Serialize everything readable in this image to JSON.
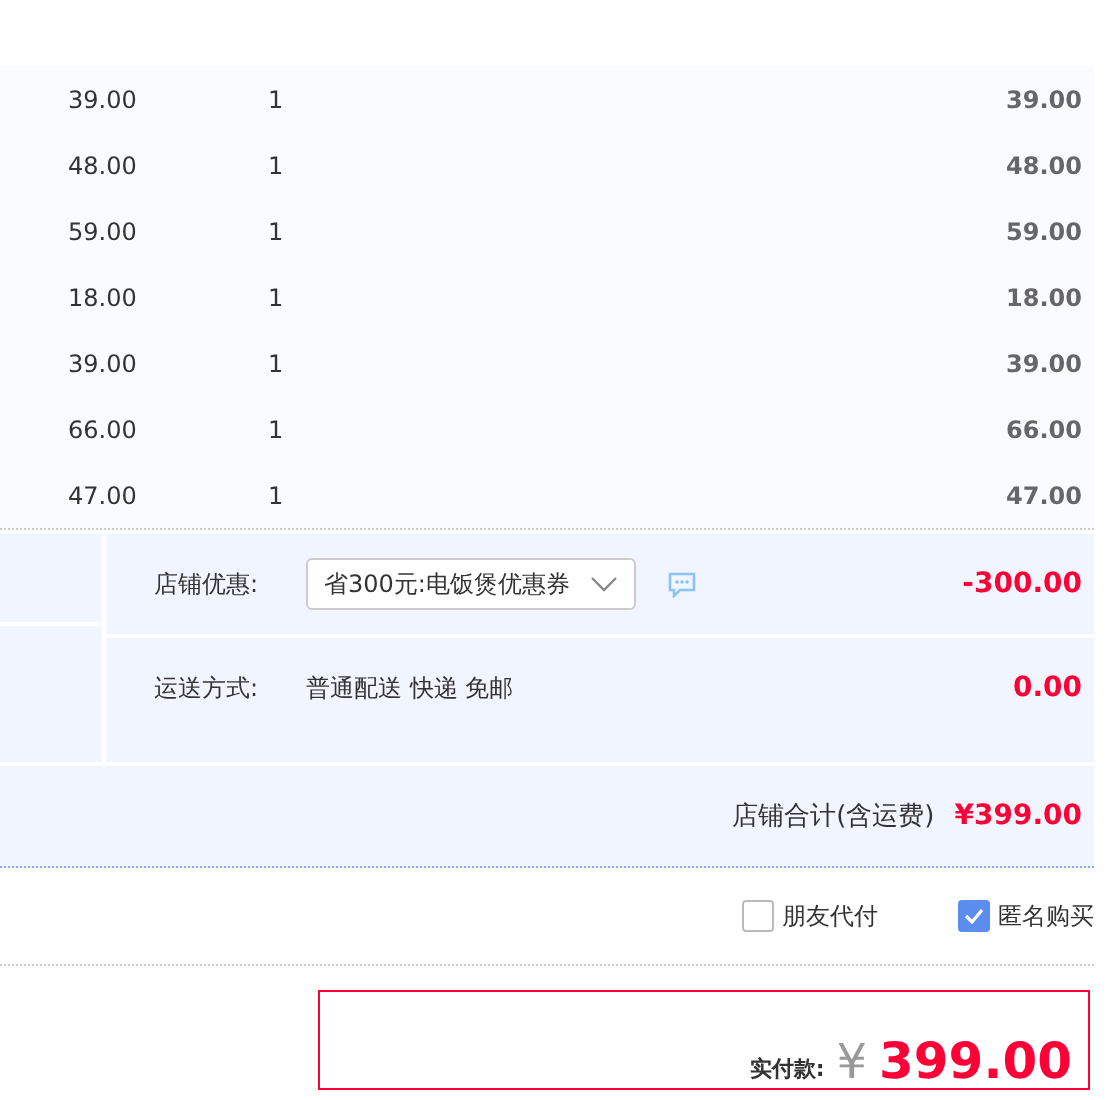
{
  "items": [
    {
      "price": "39.00",
      "quantity": "1",
      "subtotal": "39.00"
    },
    {
      "price": "48.00",
      "quantity": "1",
      "subtotal": "48.00"
    },
    {
      "price": "59.00",
      "quantity": "1",
      "subtotal": "59.00"
    },
    {
      "price": "18.00",
      "quantity": "1",
      "subtotal": "18.00"
    },
    {
      "price": "39.00",
      "quantity": "1",
      "subtotal": "39.00"
    },
    {
      "price": "66.00",
      "quantity": "1",
      "subtotal": "66.00"
    },
    {
      "price": "47.00",
      "quantity": "1",
      "subtotal": "47.00"
    }
  ],
  "shop_discount": {
    "label": "店铺优惠:",
    "selected_coupon": "省300元:电饭煲优惠券",
    "amount": "-300.00"
  },
  "shipping": {
    "label": "运送方式:",
    "method": "普通配送 快递 免邮",
    "amount": "0.00"
  },
  "shop_total": {
    "label": "店铺合计(含运费)",
    "amount": "¥399.00"
  },
  "options": [
    {
      "label": "朋友代付",
      "checked": false
    },
    {
      "label": "匿名购买",
      "checked": true
    }
  ],
  "payment": {
    "label": "实付款:",
    "currency": "¥",
    "amount": "399.00"
  }
}
